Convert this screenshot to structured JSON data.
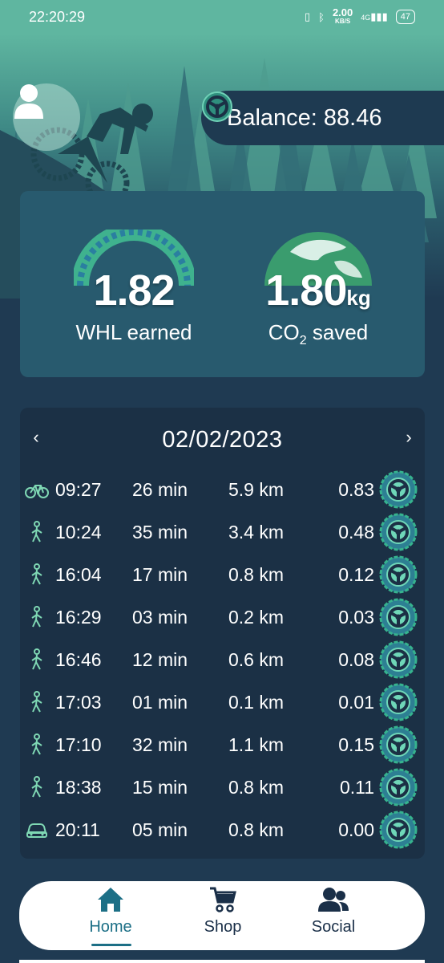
{
  "status_bar": {
    "time": "22:20:29",
    "net_speed_value": "2.00",
    "net_speed_unit": "KB/S",
    "network": "4G",
    "battery": "47"
  },
  "header": {
    "balance_label": "Balance: 88.46"
  },
  "stats": {
    "whl_value": "1.82",
    "whl_label": "WHL earned",
    "co2_value": "1.80",
    "co2_unit": "kg",
    "co2_label_main": "CO",
    "co2_label_sub": "2",
    "co2_label_rest": " saved"
  },
  "trips": {
    "date": "02/02/2023",
    "prev_icon": "chevron-left-icon",
    "next_icon": "chevron-right-icon",
    "rows": [
      {
        "mode": "bike",
        "time": "09:27",
        "duration": "26 min",
        "distance": "5.9 km",
        "earned": "0.83"
      },
      {
        "mode": "walk",
        "time": "10:24",
        "duration": "35 min",
        "distance": "3.4 km",
        "earned": "0.48"
      },
      {
        "mode": "walk",
        "time": "16:04",
        "duration": "17 min",
        "distance": "0.8 km",
        "earned": "0.12"
      },
      {
        "mode": "walk",
        "time": "16:29",
        "duration": "03 min",
        "distance": "0.2 km",
        "earned": "0.03"
      },
      {
        "mode": "walk",
        "time": "16:46",
        "duration": "12 min",
        "distance": "0.6 km",
        "earned": "0.08"
      },
      {
        "mode": "walk",
        "time": "17:03",
        "duration": "01 min",
        "distance": "0.1 km",
        "earned": "0.01"
      },
      {
        "mode": "walk",
        "time": "17:10",
        "duration": "32 min",
        "distance": "1.1 km",
        "earned": "0.15"
      },
      {
        "mode": "walk",
        "time": "18:38",
        "duration": "15 min",
        "distance": "0.8 km",
        "earned": "0.11"
      },
      {
        "mode": "car",
        "time": "20:11",
        "duration": "05 min",
        "distance": "0.8 km",
        "earned": "0.00"
      }
    ]
  },
  "nav": {
    "home": "Home",
    "shop": "Shop",
    "social": "Social",
    "active": "home"
  },
  "colors": {
    "accent": "#5fb6a0",
    "background": "#1f3a52",
    "stats_card": "#285a6e",
    "trips_card": "#1b3045",
    "nav_active": "#1c6f86",
    "mode_icon": "#7fd8b4"
  }
}
